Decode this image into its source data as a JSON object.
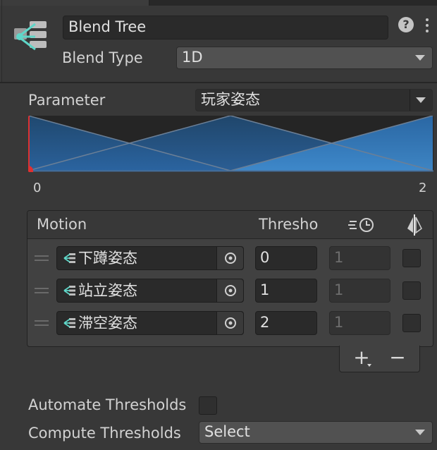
{
  "header": {
    "name_value": "Blend Tree",
    "blend_type_label": "Blend Type",
    "blend_type_value": "1D",
    "help_icon": "help-icon",
    "more_icon": "kebab-menu-icon"
  },
  "parameter": {
    "label": "Parameter",
    "value": "玩家姿态"
  },
  "graph": {
    "min_label": "0",
    "max_label": "2"
  },
  "motion_list": {
    "col_motion": "Motion",
    "col_threshold": "Thresho",
    "rows": [
      {
        "name": "下蹲姿态",
        "threshold": "0",
        "speed": "1"
      },
      {
        "name": "站立姿态",
        "threshold": "1",
        "speed": "1"
      },
      {
        "name": "滞空姿态",
        "threshold": "2",
        "speed": "1"
      }
    ],
    "add_label": "+",
    "remove_label": "−"
  },
  "automate": {
    "label": "Automate Thresholds"
  },
  "compute": {
    "label": "Compute Thresholds",
    "value": "Select"
  },
  "colors": {
    "background": "#383838",
    "blend_fill": "#2a5f94",
    "blend_fill_highlight": "#3b82c4",
    "marker": "#e03030",
    "icon_accent": "#5fd6c8"
  }
}
